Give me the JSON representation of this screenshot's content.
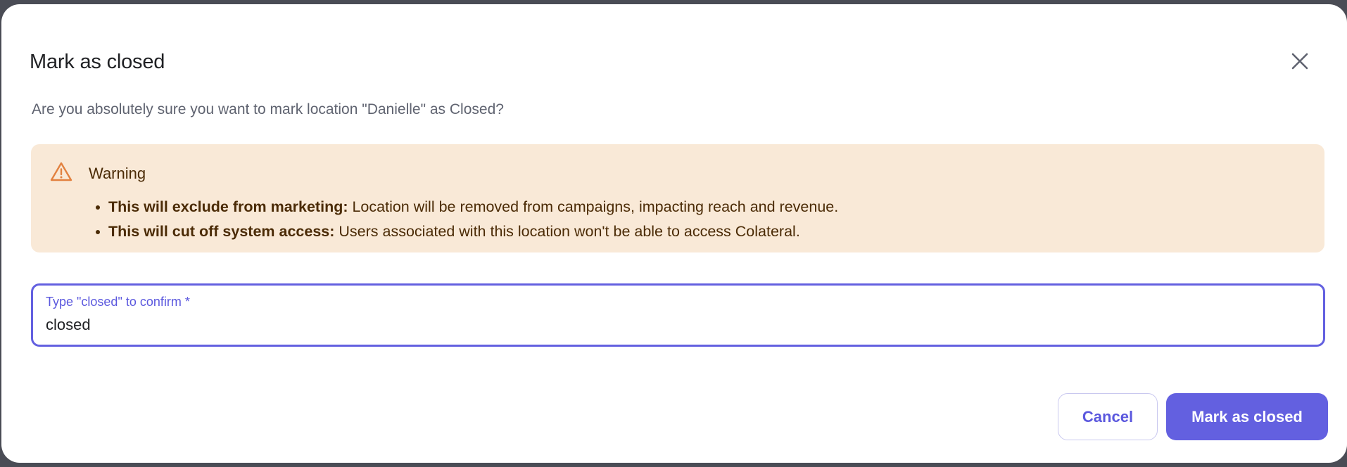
{
  "dialog": {
    "title": "Mark as closed",
    "subtitle": "Are you absolutely sure you want to mark location \"Danielle\" as Closed?",
    "close_icon": "close-icon"
  },
  "warning": {
    "icon": "warning-triangle-icon",
    "title": "Warning",
    "items": [
      {
        "bold": "This will exclude from marketing:",
        "text": " Location will be removed from campaigns, impacting reach and revenue."
      },
      {
        "bold": "This will cut off system access:",
        "text": " Users associated with this location won't be able to access Colateral."
      }
    ]
  },
  "confirm_field": {
    "label": "Type \"closed\" to confirm *",
    "value": "closed"
  },
  "actions": {
    "cancel_label": "Cancel",
    "confirm_label": "Mark as closed"
  },
  "colors": {
    "accent": "#6360e0",
    "warning_bg": "#f9e9d7",
    "warning_icon": "#e2813f",
    "warning_text": "#4b2b06"
  }
}
